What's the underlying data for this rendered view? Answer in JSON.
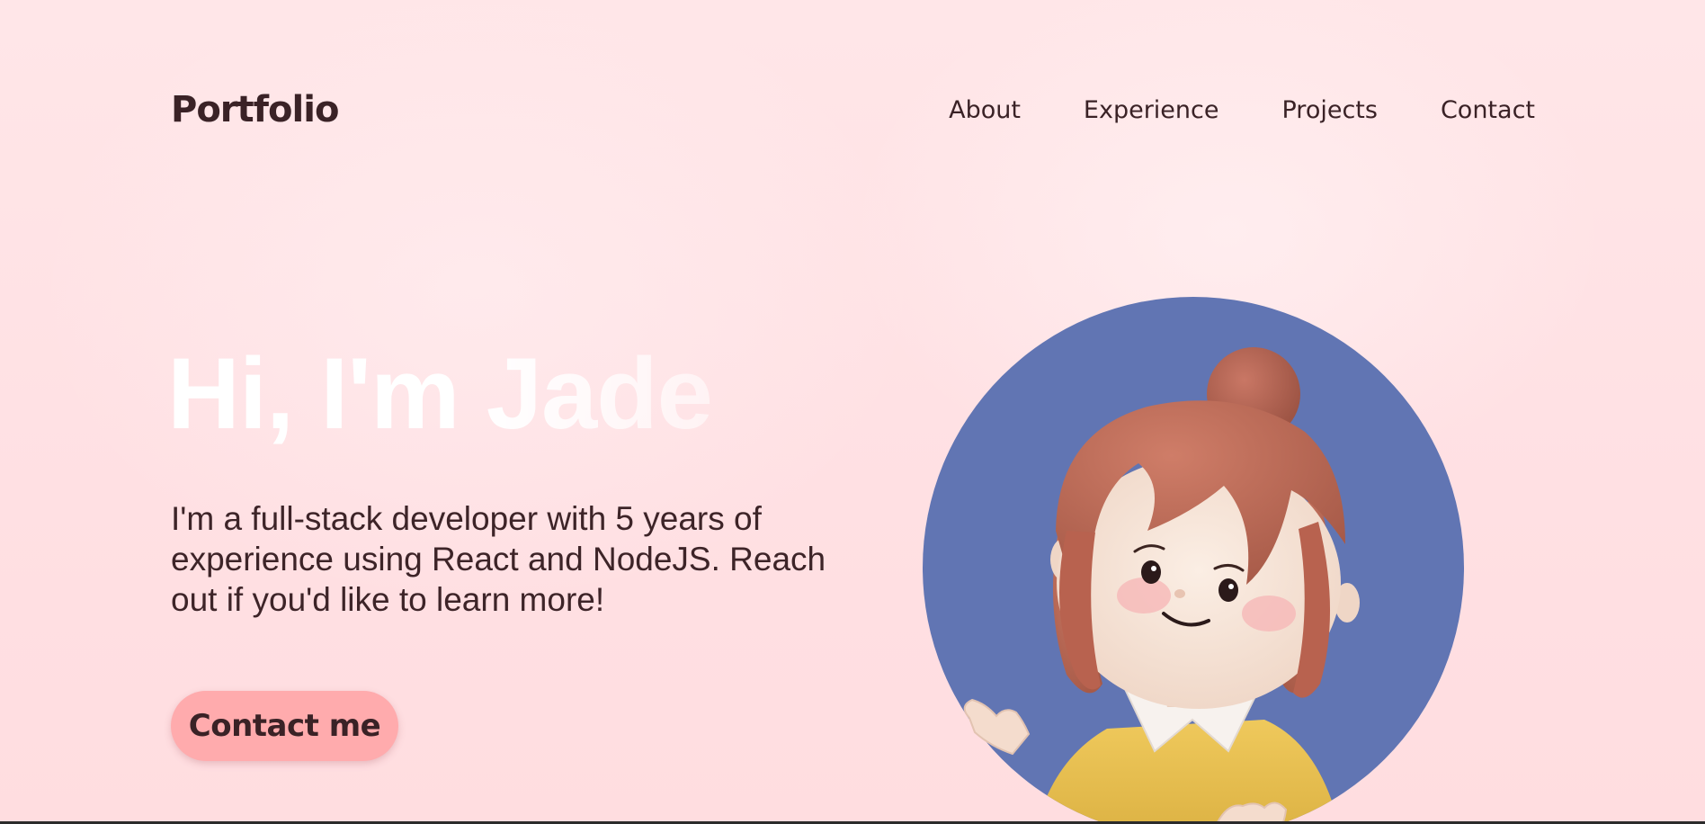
{
  "header": {
    "logo": "Portfolio",
    "nav": [
      {
        "label": "About"
      },
      {
        "label": "Experience"
      },
      {
        "label": "Projects"
      },
      {
        "label": "Contact"
      }
    ]
  },
  "hero": {
    "title": "Hi, I'm Jade",
    "description": "I'm a full-stack developer with 5 years of experience using React and NodeJS. Reach out if you'd like to learn more!",
    "cta_label": "Contact me"
  },
  "colors": {
    "background": "#ffe3e5",
    "text": "#3a2226",
    "cta": "#ffabad",
    "avatar_circle": "#6175b3",
    "hair": "#b86a57",
    "shirt": "#e6bd4f"
  },
  "icons": {
    "avatar": "cartoon-girl-avatar"
  }
}
